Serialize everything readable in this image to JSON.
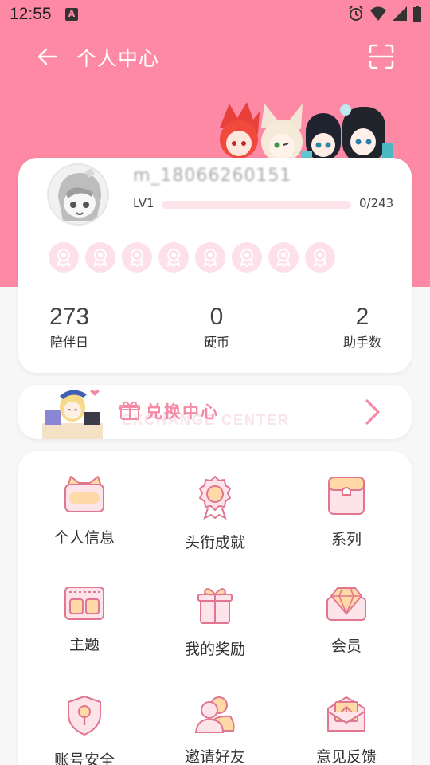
{
  "status_bar": {
    "time": "12:55",
    "notification_letter": "A"
  },
  "header": {
    "title": "个人中心"
  },
  "profile": {
    "username": "m_18066260151",
    "level_label": "LV1",
    "level_progress": "0/243",
    "badge_count": 8
  },
  "stats": [
    {
      "value": "273",
      "label": "陪伴日"
    },
    {
      "value": "0",
      "label": "硬币"
    },
    {
      "value": "2",
      "label": "助手数"
    }
  ],
  "exchange": {
    "title": "兑换中心",
    "watermark": "EXCHANGE CENTER"
  },
  "menu": [
    {
      "label": "个人信息",
      "icon": "cat-card-icon"
    },
    {
      "label": "头衔成就",
      "icon": "medal-icon"
    },
    {
      "label": "系列",
      "icon": "series-card-icon"
    },
    {
      "label": "主题",
      "icon": "theme-icon"
    },
    {
      "label": "我的奖励",
      "icon": "gift-icon"
    },
    {
      "label": "会员",
      "icon": "diamond-icon"
    },
    {
      "label": "账号安全",
      "icon": "shield-icon"
    },
    {
      "label": "邀请好友",
      "icon": "friends-icon"
    },
    {
      "label": "意见反馈",
      "icon": "feedback-envelope-icon"
    }
  ],
  "colors": {
    "accent": "#fd89a5",
    "accent_light": "#fde0e8",
    "text": "#333333"
  }
}
